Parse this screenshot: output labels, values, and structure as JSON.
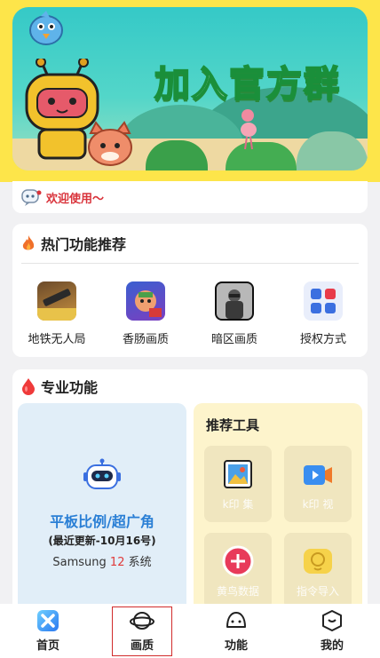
{
  "banner": {
    "title": "加入官方群"
  },
  "welcome": {
    "text": "欢迎使用～"
  },
  "hot": {
    "title": "热门功能推荐",
    "items": [
      {
        "label": "地铁无人局",
        "icon": "metro-game-icon"
      },
      {
        "label": "香肠画质",
        "icon": "sausage-game-icon"
      },
      {
        "label": "暗区画质",
        "icon": "dark-zone-game-icon"
      },
      {
        "label": "授权方式",
        "icon": "grid-blocks-icon"
      }
    ]
  },
  "pro": {
    "title": "专业功能",
    "left": {
      "line1": "平板比例/超广角",
      "line2": "(最近更新-10月16号)",
      "line3_prefix": "Samsung ",
      "line3_highlight": "12",
      "line3_suffix": " 系统"
    },
    "tools_title": "推荐工具",
    "tools": [
      {
        "label": "k印  集",
        "icon": "image-frame-icon"
      },
      {
        "label": "k印  视",
        "icon": "video-camera-icon"
      },
      {
        "label": "黄鸟数据",
        "icon": "plus-circle-icon"
      },
      {
        "label": "指令导入",
        "icon": "chat-bubble-icon"
      }
    ]
  },
  "tabbar": {
    "tabs": [
      {
        "label": "首页",
        "icon": "home-icon"
      },
      {
        "label": "画质",
        "icon": "planet-icon",
        "selected": true
      },
      {
        "label": "功能",
        "icon": "function-icon"
      },
      {
        "label": "我的",
        "icon": "profile-icon"
      }
    ]
  },
  "colors": {
    "accent_yellow": "#fde54a",
    "highlight_blue": "#2a7fd5",
    "welcome_red": "#d9333b"
  }
}
